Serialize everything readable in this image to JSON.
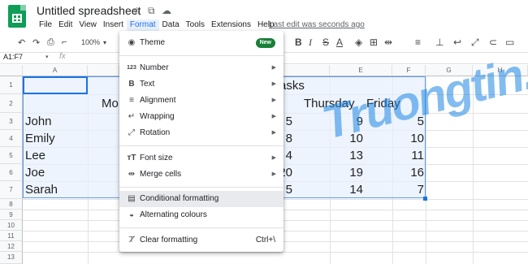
{
  "app": {
    "title": "Untitled spreadsheet",
    "last_edit": "Last edit was seconds ago"
  },
  "menubar": [
    "File",
    "Edit",
    "View",
    "Insert",
    "Format",
    "Data",
    "Tools",
    "Extensions",
    "Help"
  ],
  "toolbar": {
    "zoom": "100%"
  },
  "formula_bar": {
    "name_box": "A1:F7",
    "fx": "fx"
  },
  "columns": [
    "A",
    "B",
    "C",
    "D",
    "E",
    "F",
    "G",
    "H"
  ],
  "rows": [
    "1",
    "2",
    "3",
    "4",
    "5",
    "6",
    "7",
    "8",
    "9",
    "10",
    "11",
    "12",
    "13"
  ],
  "sheet": {
    "d1_partial": "asks",
    "b2_partial": "Mo",
    "e2": "Thursday",
    "f2": "Friday",
    "names": [
      "John",
      "Emily",
      "Lee",
      "Joe",
      "Sarah"
    ],
    "d_partial": [
      "5",
      "8",
      "4",
      "20",
      "5"
    ],
    "e_vals": [
      "9",
      "10",
      "13",
      "19",
      "14"
    ],
    "f_vals": [
      "5",
      "10",
      "11",
      "16",
      "7"
    ]
  },
  "format_menu": {
    "theme": "Theme",
    "new_badge": "New",
    "number": "Number",
    "text": "Text",
    "alignment": "Alignment",
    "wrapping": "Wrapping",
    "rotation": "Rotation",
    "font_size": "Font size",
    "merge_cells": "Merge cells",
    "conditional_formatting": "Conditional formatting",
    "alternating_colours": "Alternating colours",
    "clear_formatting": "Clear formatting",
    "clear_shortcut": "Ctrl+\\"
  },
  "watermark": "Truongtin.top",
  "colors": {
    "accent": "#1a73e8",
    "brand": "#0f9d58",
    "selection": "#e8f0fe"
  }
}
